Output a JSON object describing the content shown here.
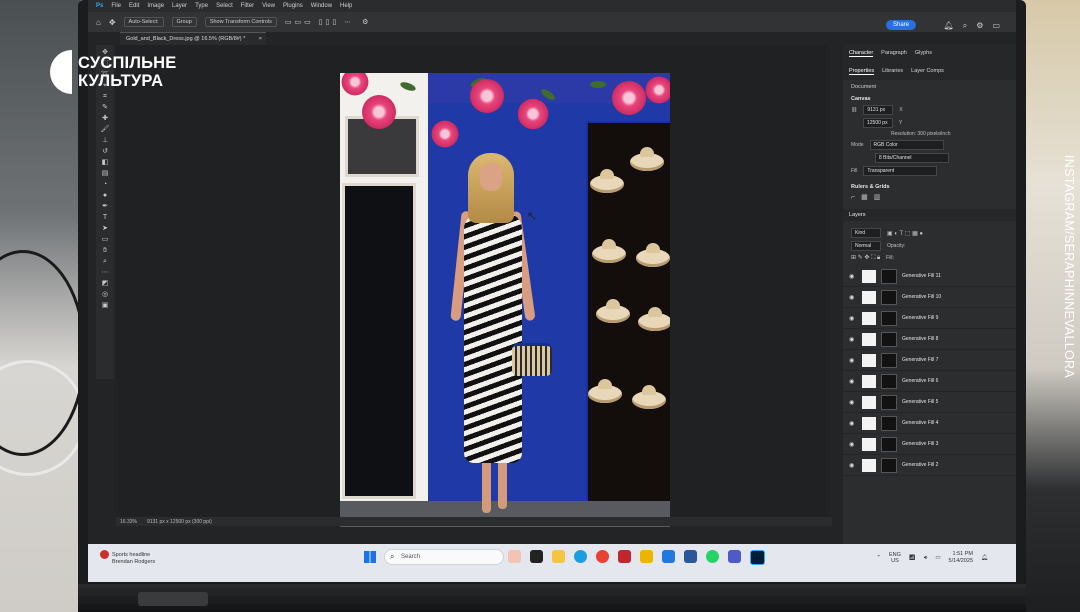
{
  "branding": {
    "line1": "СУСПІЛЬНЕ",
    "line2": "КУЛЬТУРА"
  },
  "credit": "INSTAGRAM/SERAPHINNEVALLORA",
  "menu": [
    "File",
    "Edit",
    "Image",
    "Layer",
    "Type",
    "Select",
    "Filter",
    "View",
    "Plugins",
    "Window",
    "Help"
  ],
  "options": {
    "auto_select": "Auto-Select:",
    "group": "Group",
    "transform_controls": "Show Transform Controls",
    "share": "Share"
  },
  "document_tab": {
    "title": "Gold_and_Black_Dress.jpg @ 16.5% (RGB/8#) *",
    "close": "×"
  },
  "panel_top_tabs": [
    "Character",
    "Paragraph",
    "Glyphs"
  ],
  "panel_tabs": [
    "Properties",
    "Libraries",
    "Layer Comps"
  ],
  "properties": {
    "kind": "Document",
    "canvas_header": "Canvas",
    "width": "9131 px",
    "height": "12500 px",
    "x_label": "X",
    "y_label": "Y",
    "resolution": "Resolution: 300 pixels/inch",
    "mode_label": "Mode",
    "mode": "RGB Color",
    "bit_depth": "8 Bits/Channel",
    "fill_label": "Fill",
    "fill": "Transparent",
    "rulers_header": "Rulers & Grids"
  },
  "layers": {
    "header": "Layers",
    "filter": "Kind",
    "blend": "Normal",
    "opacity_label": "Opacity:",
    "fill_label": "Fill:",
    "items": [
      "Generative Fill 11",
      "Generative Fill 10",
      "Generative Fill 9",
      "Generative Fill 8",
      "Generative Fill 7",
      "Generative Fill 6",
      "Generative Fill 5",
      "Generative Fill 4",
      "Generative Fill 3",
      "Generative Fill 2"
    ]
  },
  "status": {
    "zoom": "16.33%",
    "doc": "9131 px x 12500 px (300 ppi)"
  },
  "taskbar": {
    "news_title": "Sports headline",
    "news_sub": "Brendan Rodgers",
    "search": "Search",
    "lang1": "ENG",
    "lang2": "US",
    "time": "1:51 PM",
    "date": "5/14/2025"
  },
  "colors": {
    "accent": "#2a6fdb",
    "wall_blue": "#1f3aa6",
    "flower": "#e8467d"
  }
}
